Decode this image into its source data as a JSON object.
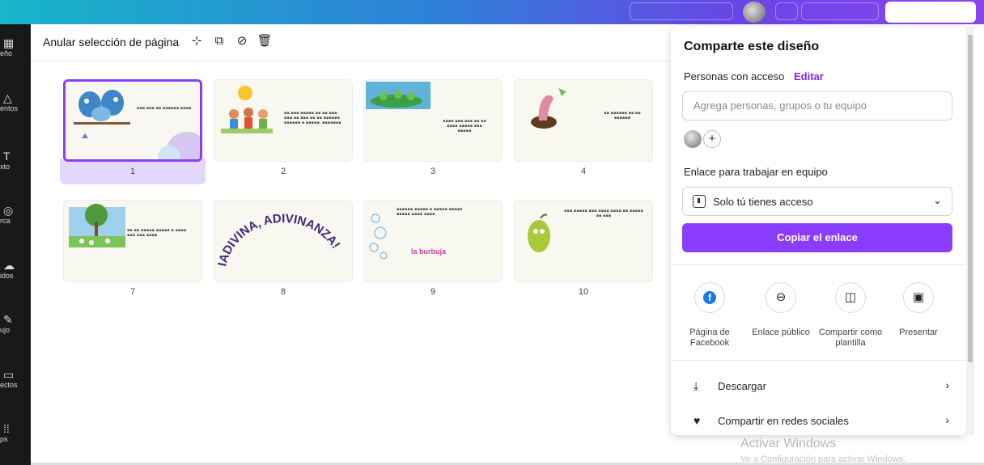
{
  "toolbar": {
    "deselect_label": "Anular selección de página"
  },
  "left_rail": [
    {
      "label": "eño",
      "icon": "layout-icon"
    },
    {
      "label": "entos",
      "icon": "elements-icon"
    },
    {
      "label": "xto",
      "icon": "text-icon"
    },
    {
      "label": "rca",
      "icon": "brand-icon"
    },
    {
      "label": "idos",
      "icon": "uploads-icon"
    },
    {
      "label": "ujo",
      "icon": "draw-icon"
    },
    {
      "label": "ectos",
      "icon": "projects-icon"
    },
    {
      "label": "ps",
      "icon": "apps-icon"
    }
  ],
  "pages": [
    {
      "number": "1",
      "selected": true
    },
    {
      "number": "2"
    },
    {
      "number": "3"
    },
    {
      "number": "4"
    },
    {
      "number": "7"
    },
    {
      "number": "8",
      "art_text": "IADIVINA, ADIVINANZA!"
    },
    {
      "number": "9",
      "caption": "la burbuja"
    },
    {
      "number": "10"
    }
  ],
  "share_panel": {
    "title": "Comparte este diseño",
    "access_label": "Personas con acceso",
    "edit_label": "Editar",
    "people_placeholder": "Agrega personas, grupos o tu equipo",
    "team_link_label": "Enlace para trabajar en equipo",
    "access_option": "Solo tú tienes acceso",
    "copy_button": "Copiar el enlace",
    "options": [
      {
        "label": "Página de Facebook",
        "icon": "facebook-icon"
      },
      {
        "label": "Enlace público",
        "icon": "link-icon"
      },
      {
        "label": "Compartir como plantilla",
        "icon": "template-icon"
      },
      {
        "label": "Presentar",
        "icon": "present-icon"
      }
    ],
    "menu": [
      {
        "label": "Descargar",
        "icon": "download-icon"
      },
      {
        "label": "Compartir en redes sociales",
        "icon": "social-heart-icon"
      }
    ],
    "accent_color": "#8b3dff"
  },
  "watermark": {
    "line1": "Activar Windows",
    "line2": "Ve a Configuración para activar Windows."
  }
}
